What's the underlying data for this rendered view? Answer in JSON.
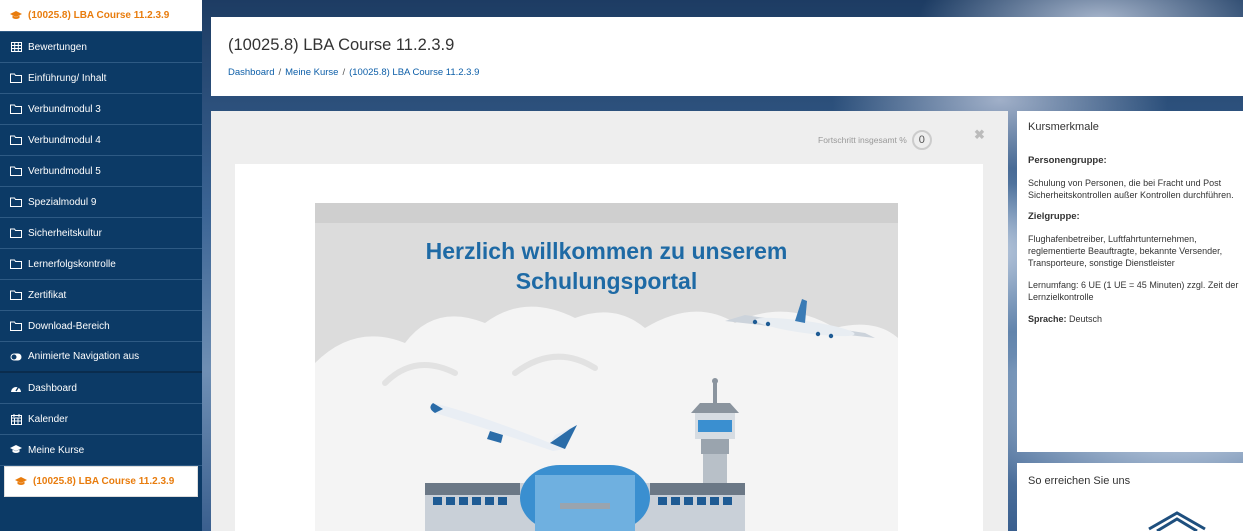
{
  "sidebar": {
    "items": [
      {
        "label": "(10025.8) LBA Course 11.2.3.9",
        "icon": "graduation-cap-icon"
      },
      {
        "label": "Bewertungen",
        "icon": "table-icon"
      },
      {
        "label": "Einführung/ Inhalt",
        "icon": "folder-icon"
      },
      {
        "label": "Verbundmodul 3",
        "icon": "folder-icon"
      },
      {
        "label": "Verbundmodul 4",
        "icon": "folder-icon"
      },
      {
        "label": "Verbundmodul 5",
        "icon": "folder-icon"
      },
      {
        "label": "Spezialmodul 9",
        "icon": "folder-icon"
      },
      {
        "label": "Sicherheitskultur",
        "icon": "folder-icon"
      },
      {
        "label": "Lernerfolgskontrolle",
        "icon": "folder-icon"
      },
      {
        "label": "Zertifikat",
        "icon": "folder-icon"
      },
      {
        "label": "Download-Bereich",
        "icon": "folder-icon"
      },
      {
        "label": "Animierte Navigation aus",
        "icon": "toggle-icon"
      },
      {
        "label": "Dashboard",
        "icon": "dashboard-icon"
      },
      {
        "label": "Kalender",
        "icon": "calendar-icon"
      },
      {
        "label": "Meine Kurse",
        "icon": "graduation-cap-icon"
      },
      {
        "label": "(10025.8) LBA Course 11.2.3.9",
        "icon": "graduation-cap-icon"
      }
    ]
  },
  "header": {
    "title": "(10025.8) LBA Course 11.2.3.9",
    "breadcrumb": [
      "Dashboard",
      "Meine Kurse",
      "(10025.8) LBA Course 11.2.3.9"
    ],
    "breadcrumb_sep": "/"
  },
  "main": {
    "progress_label": "Fortschritt insgesamt %",
    "progress_value": "0",
    "close_glyph": "✖",
    "welcome_line1": "Herzlich willkommen zu unserem",
    "welcome_line2": "Schulungsportal"
  },
  "panel": {
    "title": "Kursmerkmale",
    "personengruppe_heading": "Personengruppe:",
    "personengruppe_text": "Schulung von Personen, die bei Fracht und Post Sicherheitskontrollen außer Kontrollen durchführen.",
    "zielgruppe_heading": "Zielgruppe:",
    "zielgruppe_text": "Flughafenbetreiber, Luftfahrtunternehmen, reglementierte Beauftragte, bekannte Versender, Transporteure, sonstige Dienstleister",
    "lernumfang": "Lernumfang: 6 UE (1 UE = 45 Minuten) zzgl. Zeit der Lernzielkontrolle",
    "sprache_label": "Sprache:",
    "sprache_value": "Deutsch"
  },
  "panel2": {
    "title": "So erreichen Sie uns"
  },
  "colors": {
    "sidebar_bg": "#0c3a66",
    "accent_orange": "#e87c0d",
    "link_blue": "#0c5ea8",
    "welcome_blue": "#1e6aa5"
  }
}
